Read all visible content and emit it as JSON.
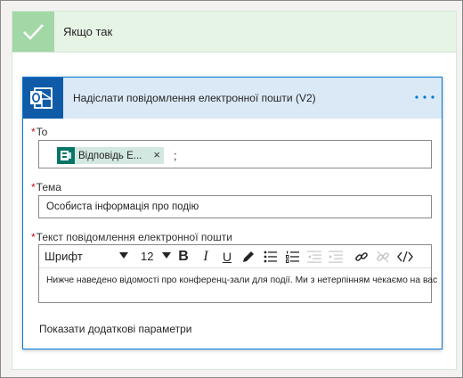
{
  "condition": {
    "title": "Якщо так",
    "colors": {
      "header_bg": "#e6f4e6",
      "check_bg": "#a2d7a6"
    }
  },
  "action": {
    "title": "Надіслати повідомлення електронної пошти (V2)",
    "icon": "outlook-icon",
    "more_icon": "more-dots-icon",
    "accent_color": "#0078d4",
    "header_bg": "#dbe9f7"
  },
  "fields": {
    "to": {
      "required_mark": "*",
      "label": "To",
      "token_label": "Відповідь Е...",
      "token_icon": "forms-icon",
      "token_close": "×",
      "separator": ";"
    },
    "subject": {
      "required_mark": "*",
      "label": "Тема",
      "value": "Особиста інформація про подію"
    },
    "body": {
      "required_mark": "*",
      "label": "Текст повідомлення електронної пошти",
      "value": "Нижче наведено відомості про конференц-зали для події. Ми з нетерпінням чекаємо на вас"
    }
  },
  "toolbar": {
    "font_label": "Шрифт",
    "size_label": "12",
    "bold": "B",
    "italic": "I",
    "underline": "U"
  },
  "advanced_link": "Показати додаткові параметри"
}
